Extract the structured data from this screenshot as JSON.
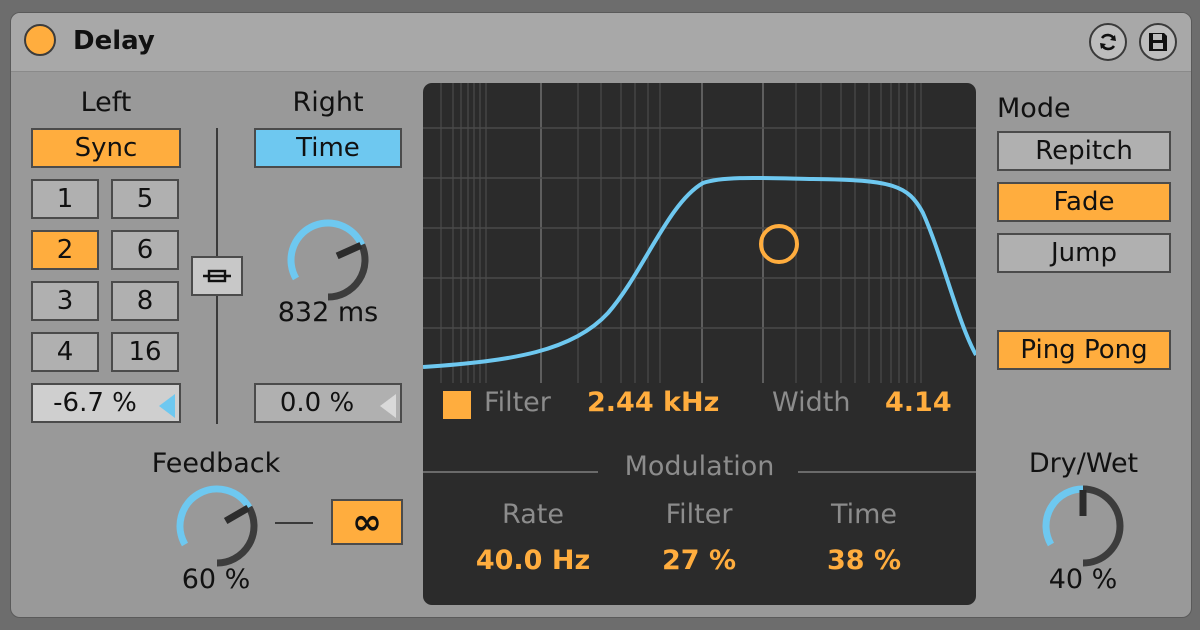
{
  "device": {
    "title": "Delay",
    "power_on": true,
    "accent_color": "#ffad3e",
    "blue_color": "#6ec8f0"
  },
  "left": {
    "label": "Left",
    "sync_label": "Sync",
    "beat_buttons": [
      "1",
      "5",
      "2",
      "6",
      "3",
      "8",
      "4",
      "16"
    ],
    "selected_beat": "2",
    "offset": "-6.7 %"
  },
  "right": {
    "label": "Right",
    "time_label": "Time",
    "time_value": "832 ms",
    "time_knob_level": 0.62,
    "offset": "0.0 %"
  },
  "feedback": {
    "label": "Feedback",
    "value": "60 %",
    "knob_level": 0.6,
    "freeze_symbol": "∞"
  },
  "filter_display": {
    "filter_label": "Filter",
    "filter_on": true,
    "frequency": "2.44 kHz",
    "width_label": "Width",
    "width_value": "4.14"
  },
  "modulation": {
    "heading": "Modulation",
    "rate_label": "Rate",
    "rate_value": "40.0 Hz",
    "filter_label": "Filter",
    "filter_value": "27 %",
    "time_label": "Time",
    "time_value": "38 %"
  },
  "mode": {
    "label": "Mode",
    "options": [
      "Repitch",
      "Fade",
      "Jump"
    ],
    "selected": "Fade",
    "ping_pong_label": "Ping Pong",
    "ping_pong_on": true
  },
  "dry_wet": {
    "label": "Dry/Wet",
    "value": "40 %",
    "knob_level": 0.4
  },
  "icons": {
    "device_header_icons": [
      "refresh-icon",
      "save-icon"
    ],
    "link_icon": "link-icon"
  }
}
